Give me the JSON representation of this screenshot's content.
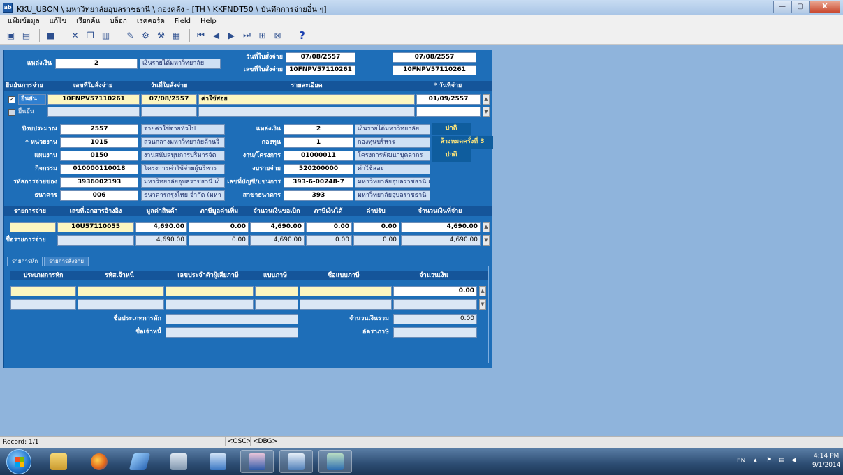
{
  "window": {
    "title": "KKU_UBON \\ มหาวิทยาลัยอุบลราชธานี \\ กองคลัง - [TH \\ KKFNDT50 \\ บันทึกการจ่ายอื่น ๆ]",
    "app_icon": "ab-icon",
    "minimize": "—",
    "maximize": "▢",
    "close": "X"
  },
  "menu": [
    "แฟ้มข้อมูล",
    "แก้ไข",
    "เรียกค้น",
    "บล็อก",
    "เรคคอร์ด",
    "Field",
    "Help"
  ],
  "toolbar": {
    "help": "?"
  },
  "form": {
    "source_label": "แหล่งเงิน",
    "source_value": "2",
    "source_desc": "เงินรายได้มหาวิทยาลัย",
    "order_date_label": "วันที่ใบสั่งจ่าย",
    "order_no_label": "เลขที่ใบสั่งจ่าย",
    "order_date_from": "07/08/2557",
    "order_date_to": "07/08/2557",
    "order_no_from": "10FNPV57110261",
    "order_no_to": "10FNPV57110261",
    "grid_headers": {
      "confirm": "ยืนยันการจ่าย",
      "order_no": "เลขที่ใบสั่งจ่าย",
      "order_date": "วันที่ใบสั่งจ่าย",
      "detail": "รายละเอียด",
      "pay_date": "* วันที่จ่าย"
    },
    "rows": [
      {
        "checked": true,
        "confirm": "ยืนยัน",
        "order_no": "10FNPV57110261",
        "order_date": "07/08/2557",
        "detail": "ค่าใช้สอย",
        "pay_date": "01/09/2557"
      },
      {
        "checked": false,
        "confirm": "ยืนยัน",
        "order_no": "",
        "order_date": "",
        "detail": "",
        "pay_date": ""
      }
    ],
    "details": {
      "fiscal_year_label": "ปีงบประมาณ",
      "fiscal_year": "2557",
      "fiscal_year_desc": "จ่ายค่าใช้จ่ายทั่วไป",
      "unit_label": "* หน่วยงาน",
      "unit": "1015",
      "unit_desc": "ส่วนกลางมหาวิทยาลัยด้านวิ",
      "plan_label": "แผนงาน",
      "plan": "0150",
      "plan_desc": "งานสนับสนุนการบริหารจัด",
      "activity_label": "กิจกรรม",
      "activity": "010000110018",
      "activity_desc": "โครงการค่าใช้จ่ายผู้บริหาร",
      "payee_label": "รหัสการจ่ายของ",
      "payee": "3936002193",
      "payee_desc": "มหาวิทยาลัยอุบลราชธานี เงิ",
      "bank_label": "ธนาคาร",
      "bank": "006",
      "bank_desc": "ธนาคารกรุงไทย จำกัด (มหา",
      "source_label": "แหล่งเงิน",
      "source": "2",
      "source_desc": "เงินรายได้มหาวิทยาลัย",
      "fund_label": "กองทุน",
      "fund": "1",
      "fund_desc": "กองทุนบริหาร",
      "project_label": "งาน/โครงการ",
      "project": "01000011",
      "project_desc": "โครงการพัฒนาบุคลากร",
      "expense_label": "งบรายจ่าย",
      "expense": "520200000",
      "expense_desc": "ค่าใช้สอย",
      "account_label": "เลขที่บัญชี/บชนการ",
      "account": "393-6-00248-7",
      "account_desc": "มหาวิทยาลัยอุบลราชธานี เงิน",
      "branch_label": "สาขาธนาคาร",
      "branch": "393",
      "branch_desc": "มหาวิทยาลัยอุบลราชธานี",
      "status1": "ปกติ",
      "status2": "ล้างหมดครั้งที่ 3",
      "status3": "ปกติ"
    },
    "amounts": {
      "headers": {
        "item": "รายการจ่าย",
        "ref_doc": "เลขที่เอกสารอ้างอิง",
        "value": "มูลค่าสินค้า",
        "vat": "ภาษีมูลค่าเพิ่ม",
        "total": "จำนวนเงินขอเบิก",
        "wht": "ภาษีเงินได้",
        "fine": "ค่าปรับ",
        "net": "จำนวนเงินที่จ่าย"
      },
      "row": {
        "ref_doc": "10U57110055",
        "value": "4,690.00",
        "vat": "0.00",
        "total": "4,690.00",
        "wht": "0.00",
        "fine": "0.00",
        "net": "4,690.00"
      },
      "summary_label": "ชื่อรายการจ่าย",
      "summary": {
        "value": "4,690.00",
        "vat": "0.00",
        "total": "4,690.00",
        "wht": "0.00",
        "fine": "0.00",
        "net": "4,690.00"
      }
    },
    "tabs": [
      "รายการหัก",
      "รายการสั่งจ่าย"
    ],
    "deductions": {
      "headers": {
        "type": "ประเภทการหัก",
        "creditor": "รหัสเจ้าหนี้",
        "taxid": "เลขประจำตัวผู้เสียภาษี",
        "form": "แบบภาษี",
        "form_name": "ชื่อแบบภาษี",
        "amount": "จำนวนเงิน"
      },
      "row_amount": "0.00",
      "type_name_label": "ชื่อประเภทการหัก",
      "creditor_name_label": "ชื่อเจ้าหนี้",
      "total_label": "จำนวนเงินรวม",
      "total": "0.00",
      "rate_label": "อัตราภาษี"
    }
  },
  "status": {
    "record": "Record: 1/1",
    "osc": "<OSC>",
    "dbg": "<DBG>"
  },
  "tray": {
    "lang": "EN",
    "time": "4:14 PM",
    "date": "9/1/2014"
  }
}
